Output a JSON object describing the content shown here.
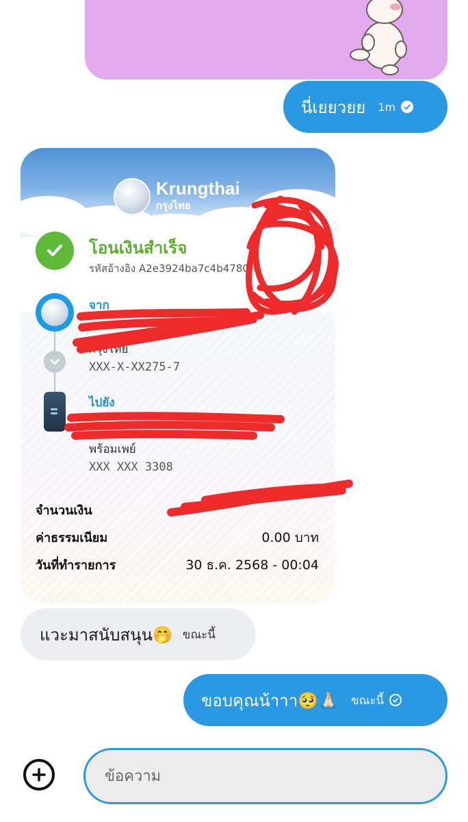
{
  "messages": {
    "sent_1": {
      "text": "นี่เยยวยย",
      "time": "1m"
    },
    "received_1": {
      "text": "แวะมาสนับสนุน🤭",
      "time": "ขณะนี้"
    },
    "sent_2": {
      "text": "ขอบคุณน้าาา🥺🙏🏻",
      "time": "ขณะนี้"
    }
  },
  "receipt": {
    "bank_name": "Krungthai",
    "bank_name_th": "กรุงไทย",
    "status": "โอนเงินสำเร็จ",
    "reference": "รหัสอ้างอิง A2e3924ba7c4b4780",
    "from_label": "จาก",
    "from_bank": "กรุงไทย",
    "from_account": "XXX-X-XX275-7",
    "to_label": "ไปยัง",
    "to_service": "พร้อมเพย์",
    "to_account": "XXX XXX 3308",
    "rows": [
      {
        "label": "จำนวนเงิน",
        "value": ""
      },
      {
        "label": "ค่าธรรมเนียม",
        "value": "0.00 บาท"
      },
      {
        "label": "วันที่ทำรายการ",
        "value": "30 ธ.ค. 2568 - 00:04"
      }
    ]
  },
  "composer": {
    "placeholder": "ข้อความ"
  },
  "colors": {
    "bubble_sent": "#2b98e4",
    "bubble_received": "#eceef1",
    "sticker_bg": "#e2a9ee",
    "success_green": "#5fba3a",
    "redaction": "#ee2a2a"
  }
}
